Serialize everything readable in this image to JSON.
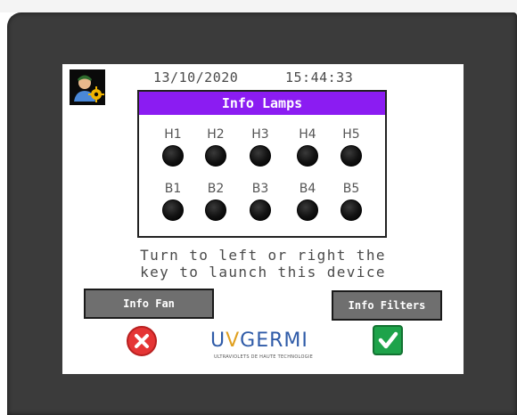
{
  "header": {
    "date": "13/10/2020",
    "time": "15:44:33"
  },
  "lamps": {
    "title": "Info Lamps",
    "top_row": [
      "H1",
      "H2",
      "H3",
      "H4",
      "H5"
    ],
    "bottom_row": [
      "B1",
      "B2",
      "B3",
      "B4",
      "B5"
    ]
  },
  "message": {
    "line1": "Turn to left or right the",
    "line2": "key to launch this device"
  },
  "buttons": {
    "fan_label": "Info Fan",
    "filters_label": "Info Filters"
  },
  "logo": {
    "brand": "UVGERMI",
    "tagline": "ULTRAVIOLETS DE HAUTE TECHNOLOGIE"
  },
  "colors": {
    "header_purple": "#8b1cf2",
    "cancel_red": "#e53535",
    "confirm_green": "#1ea34a"
  },
  "icons": {
    "user": "user-settings-icon",
    "cancel": "cancel-x-icon",
    "confirm": "checkmark-icon"
  }
}
